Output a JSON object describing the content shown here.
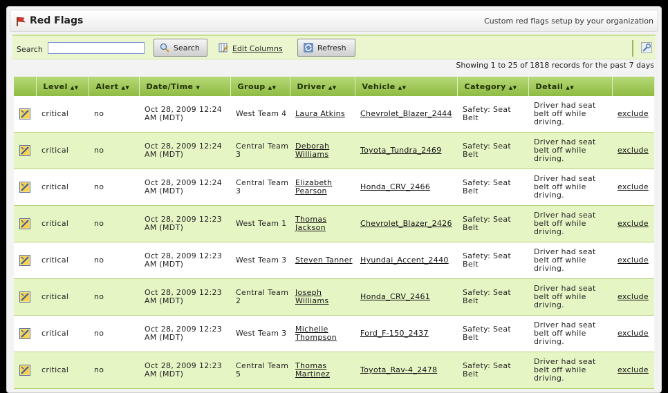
{
  "title": "Red Flags",
  "subtitle": "Custom red flags setup by your organization",
  "toolbar": {
    "search_label": "Search",
    "search_value": "",
    "search_button": "Search",
    "edit_columns": "Edit Columns",
    "refresh": "Refresh"
  },
  "showing": "Showing 1 to 25 of 1818 records for the past 7 days",
  "columns": [
    "Level",
    "Alert",
    "Date/Time",
    "Group",
    "Driver",
    "Vehicle",
    "Category",
    "Detail"
  ],
  "rows": [
    {
      "level": "critical",
      "alert": "no",
      "datetime": "Oct 28, 2009 12:24 AM (MDT)",
      "group": "West Team 4",
      "driver": "Laura Atkins",
      "vehicle": "Chevrolet_Blazer_2444",
      "category": "Safety: Seat Belt",
      "detail": "Driver had seat belt off while driving.",
      "action": "exclude"
    },
    {
      "level": "critical",
      "alert": "no",
      "datetime": "Oct 28, 2009 12:24 AM (MDT)",
      "group": "Central Team 3",
      "driver": "Deborah Williams",
      "vehicle": "Toyota_Tundra_2469",
      "category": "Safety: Seat Belt",
      "detail": "Driver had seat belt off while driving.",
      "action": "exclude"
    },
    {
      "level": "critical",
      "alert": "no",
      "datetime": "Oct 28, 2009 12:24 AM (MDT)",
      "group": "Central Team 3",
      "driver": "Elizabeth Pearson",
      "vehicle": "Honda_CRV_2466",
      "category": "Safety: Seat Belt",
      "detail": "Driver had seat belt off while driving.",
      "action": "exclude"
    },
    {
      "level": "critical",
      "alert": "no",
      "datetime": "Oct 28, 2009 12:23 AM (MDT)",
      "group": "West Team 1",
      "driver": "Thomas Jackson",
      "vehicle": "Chevrolet_Blazer_2426",
      "category": "Safety: Seat Belt",
      "detail": "Driver had seat belt off while driving.",
      "action": "exclude"
    },
    {
      "level": "critical",
      "alert": "no",
      "datetime": "Oct 28, 2009 12:23 AM (MDT)",
      "group": "West Team 3",
      "driver": "Steven Tanner",
      "vehicle": "Hyundai_Accent_2440",
      "category": "Safety: Seat Belt",
      "detail": "Driver had seat belt off while driving.",
      "action": "exclude"
    },
    {
      "level": "critical",
      "alert": "no",
      "datetime": "Oct 28, 2009 12:23 AM (MDT)",
      "group": "Central Team 2",
      "driver": "Joseph Williams",
      "vehicle": "Honda_CRV_2461",
      "category": "Safety: Seat Belt",
      "detail": "Driver had seat belt off while driving.",
      "action": "exclude"
    },
    {
      "level": "critical",
      "alert": "no",
      "datetime": "Oct 28, 2009 12:23 AM (MDT)",
      "group": "West Team 3",
      "driver": "Michelle Thompson",
      "vehicle": "Ford_F-150_2437",
      "category": "Safety: Seat Belt",
      "detail": "Driver had seat belt off while driving.",
      "action": "exclude"
    },
    {
      "level": "critical",
      "alert": "no",
      "datetime": "Oct 28, 2009 12:23 AM (MDT)",
      "group": "Central Team 5",
      "driver": "Thomas Martinez",
      "vehicle": "Toyota_Rav-4_2478",
      "category": "Safety: Seat Belt",
      "detail": "Driver had seat belt off while driving.",
      "action": "exclude"
    }
  ]
}
